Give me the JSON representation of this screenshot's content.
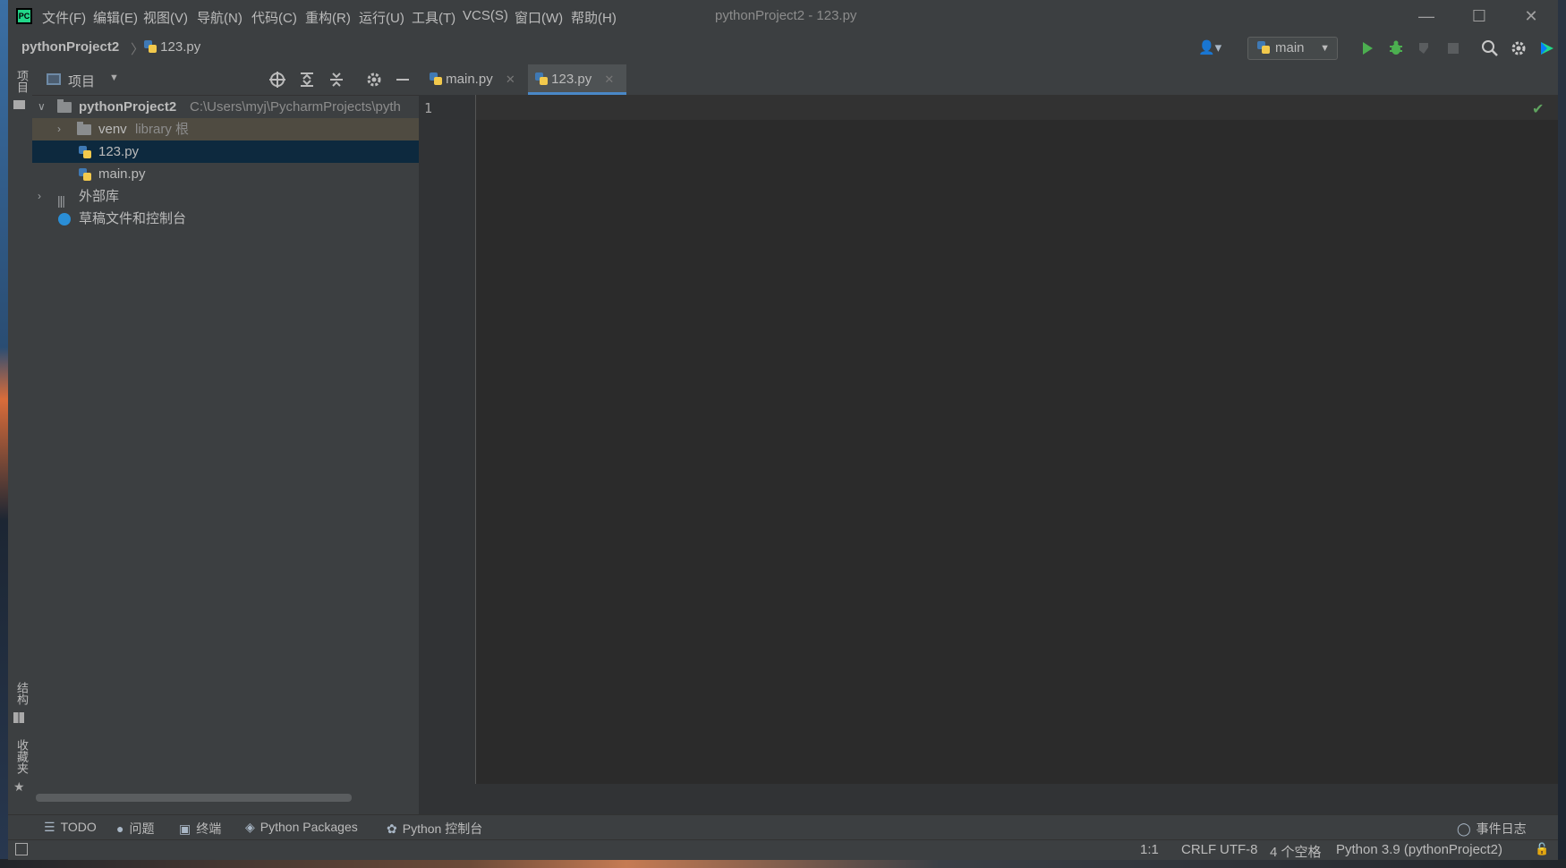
{
  "app": {
    "logo_text": "PC",
    "window_title": "pythonProject2 - 123.py"
  },
  "menu": [
    "文件(F)",
    "编辑(E)",
    "视图(V)",
    "导航(N)",
    "代码(C)",
    "重构(R)",
    "运行(U)",
    "工具(T)",
    "VCS(S)",
    "窗口(W)",
    "帮助(H)"
  ],
  "window_controls": {
    "minimize": "—",
    "maximize": "☐",
    "close": "✕"
  },
  "breadcrumb": {
    "project": "pythonProject2",
    "separator": "〉",
    "file": "123.py"
  },
  "toolbar": {
    "user_icon": "user-icon",
    "run_config": "main",
    "icons": [
      "run-icon",
      "debug-icon",
      "coverage-icon",
      "stop-icon",
      "search-icon",
      "gear-icon",
      "toolbox-icon"
    ]
  },
  "left_strip": {
    "project_label": "项目",
    "structure_label": "结构",
    "favorites_label": "收藏夹"
  },
  "project_panel": {
    "title": "项目",
    "tree": {
      "root_name": "pythonProject2",
      "root_path": "C:\\Users\\myj\\PycharmProjects\\pyth",
      "venv_name": "venv",
      "venv_hint": "library 根",
      "file1": "123.py",
      "file2": "main.py",
      "ext_libs": "外部库",
      "scratches": "草稿文件和控制台"
    }
  },
  "editor": {
    "tabs": [
      {
        "label": "main.py",
        "active": false
      },
      {
        "label": "123.py",
        "active": true
      }
    ],
    "line_number": "1"
  },
  "bottom_tools": [
    "TODO",
    "问题",
    "终端",
    "Python Packages",
    "Python 控制台"
  ],
  "event_log": "事件日志",
  "status": {
    "position": "1:1",
    "line_sep": "CRLF",
    "encoding": "UTF-8",
    "indent": "4 个空格",
    "interpreter": "Python 3.9 (pythonProject2)"
  },
  "colors": {
    "accent": "#4a88c7",
    "selection": "#0d293e",
    "run_green": "#4caf50"
  }
}
